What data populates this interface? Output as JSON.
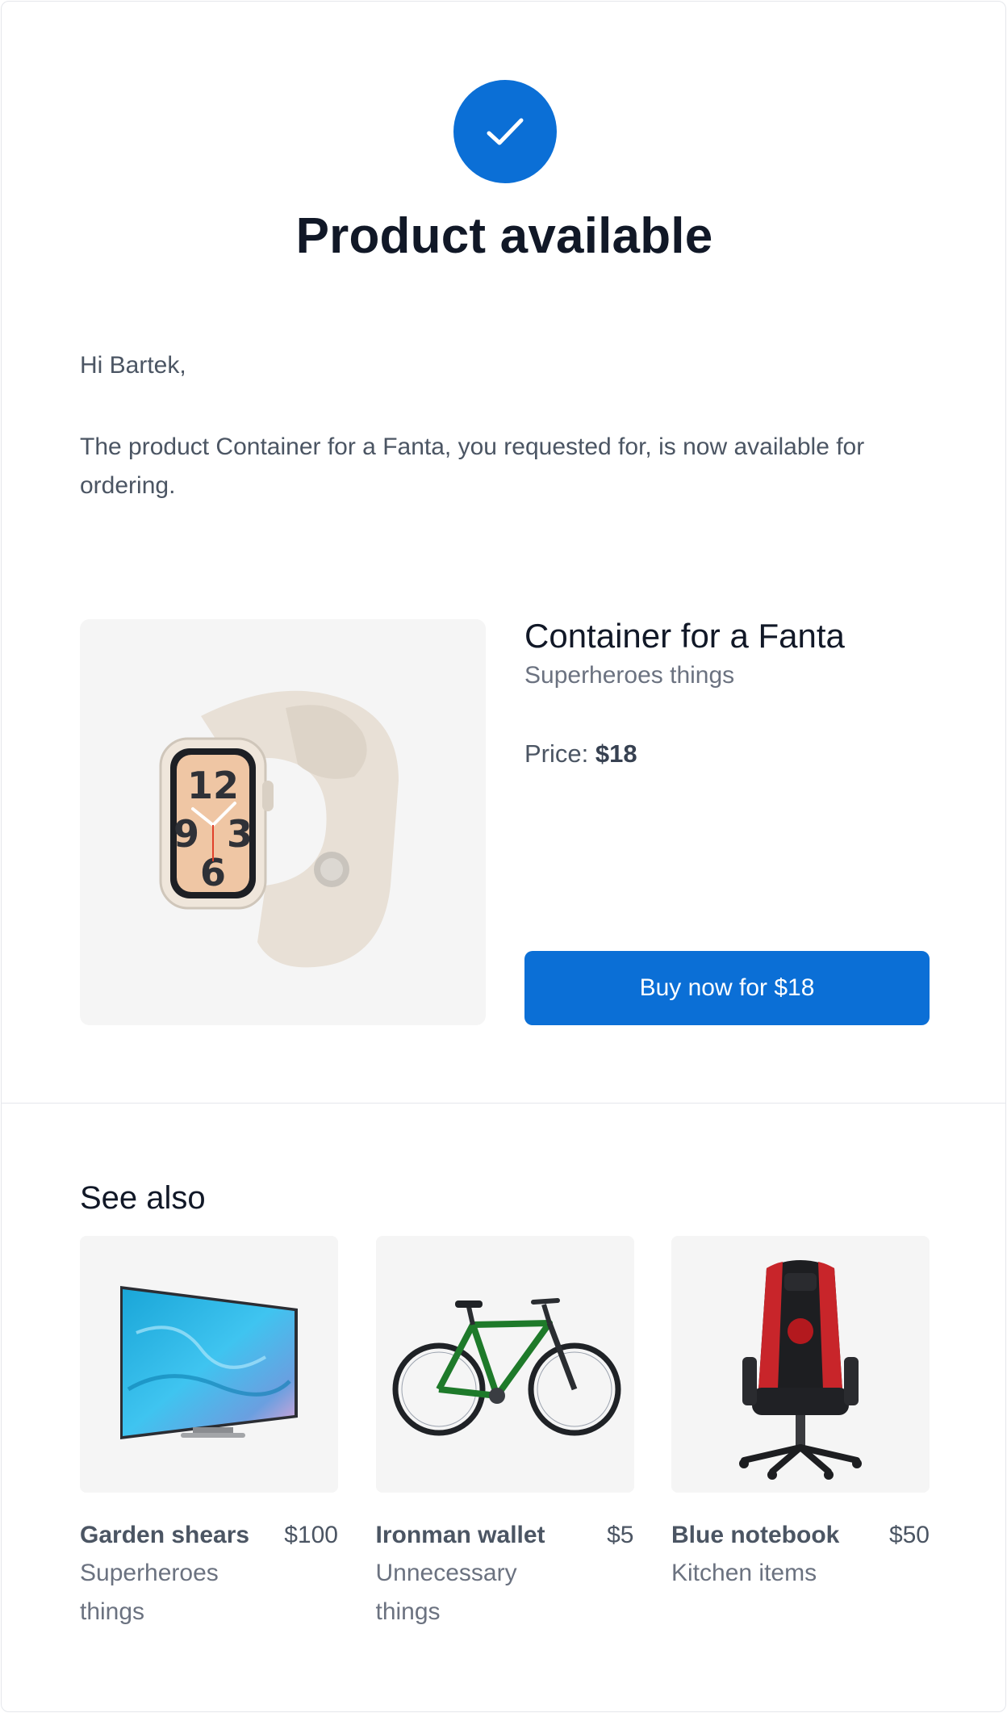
{
  "header": {
    "title": "Product available"
  },
  "message": {
    "greeting": "Hi Bartek,",
    "body": "The product Container for a Fanta, you requested for, is now available for ordering."
  },
  "product": {
    "name": "Container for a Fanta",
    "category": "Superheroes things",
    "price_label": "Price:",
    "price": "$18",
    "image_icon": "smartwatch-icon",
    "buy_button_label": "Buy now for $18"
  },
  "see_also": {
    "heading": "See also",
    "items": [
      {
        "name": "Garden shears",
        "price": "$100",
        "category": "Superheroes things",
        "image_icon": "television-icon"
      },
      {
        "name": "Ironman wallet",
        "price": "$5",
        "category": "Unnecessary things",
        "image_icon": "bicycle-icon"
      },
      {
        "name": "Blue notebook",
        "price": "$50",
        "category": "Kitchen items",
        "image_icon": "gaming-chair-icon"
      }
    ]
  },
  "colors": {
    "accent": "#0b6fd6",
    "image_background": "#f5f5f5",
    "text_primary": "#111827",
    "text_secondary": "#4b5563",
    "text_muted": "#6b7280"
  }
}
